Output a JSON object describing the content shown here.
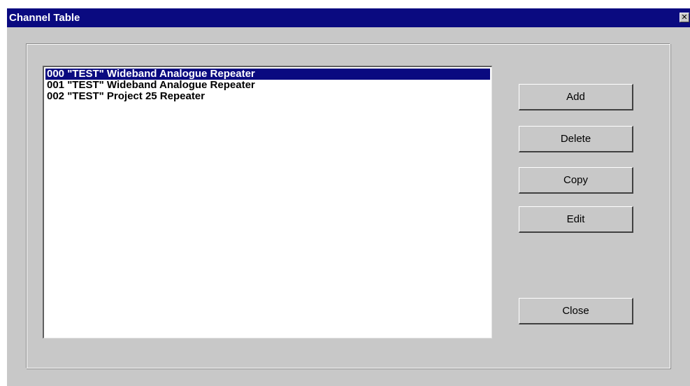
{
  "window": {
    "title": "Channel Table",
    "close_glyph": "✕"
  },
  "channels": {
    "items": [
      {
        "label": "000 \"TEST\" Wideband Analogue Repeater",
        "selected": true
      },
      {
        "label": "001 \"TEST\" Wideband Analogue Repeater",
        "selected": false
      },
      {
        "label": "002 \"TEST\" Project 25 Repeater",
        "selected": false
      }
    ]
  },
  "buttons": {
    "add_label": "Add",
    "delete_label": "Delete",
    "copy_label": "Copy",
    "edit_label": "Edit",
    "close_label": "Close"
  },
  "colors": {
    "titlebar": "#0a0a80",
    "face": "#c8c8c8",
    "selection": "#0a0a80"
  },
  "icons": {
    "close": "close-icon"
  }
}
